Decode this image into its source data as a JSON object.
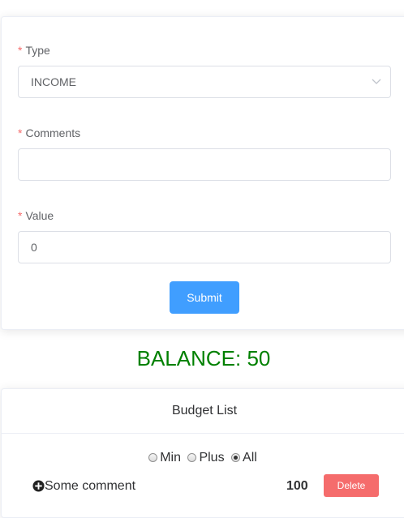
{
  "form": {
    "type_label": "Type",
    "type_value": "INCOME",
    "comments_label": "Comments",
    "comments_value": "",
    "value_label": "Value",
    "value_value": "0",
    "required_mark": "*",
    "submit_label": "Submit"
  },
  "balance": {
    "text": "BALANCE: 50",
    "color": "#008000"
  },
  "budget_list": {
    "title": "Budget List",
    "filters": [
      {
        "label": "Min",
        "checked": false
      },
      {
        "label": "Plus",
        "checked": false
      },
      {
        "label": "All",
        "checked": true
      }
    ],
    "items": [
      {
        "icon": "plus-circle-icon",
        "comment": "Some comment",
        "value": "100",
        "delete_label": "Delete"
      }
    ]
  },
  "colors": {
    "primary": "#409eff",
    "danger": "#f56c6c",
    "balance": "#008000"
  }
}
